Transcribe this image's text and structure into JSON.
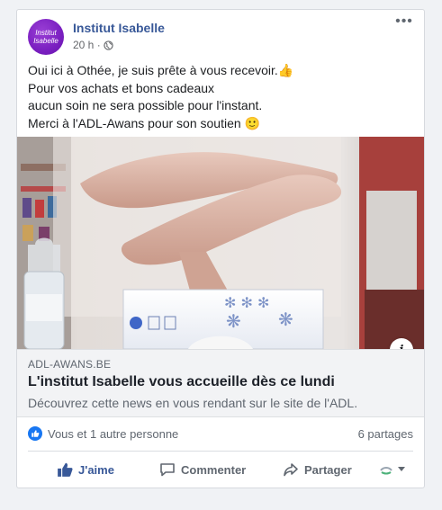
{
  "post": {
    "page_name": "Institut Isabelle",
    "avatar_text_line1": "Institut",
    "avatar_text_line2": "Isabelle",
    "time": "20 h ·",
    "text_lines": [
      "Oui ici à Othée, je suis prête à vous recevoir.👍",
      "Pour vos achats et bons cadeaux",
      "aucun soin ne sera possible pour l'instant.",
      "Merci à l'ADL-Awans pour son soutien 🙂"
    ],
    "more_label": "•••"
  },
  "link": {
    "domain": "ADL-AWANS.BE",
    "title": "L'institut Isabelle vous accueille dès ce lundi",
    "description": "Découvrez cette news en vous rendant sur le site de l'ADL.",
    "info_label": "i"
  },
  "stats": {
    "reactions": "Vous et 1 autre personne",
    "shares": "6 partages"
  },
  "actions": {
    "like": "J'aime",
    "comment": "Commenter",
    "share": "Partager"
  },
  "colors": {
    "brand_blue": "#385898",
    "like_blue": "#1877f2",
    "avatar_purple": "#7a1fc0"
  },
  "icons": [
    "globe-icon",
    "like-icon",
    "comment-icon",
    "share-icon",
    "more-icon",
    "info-icon"
  ]
}
